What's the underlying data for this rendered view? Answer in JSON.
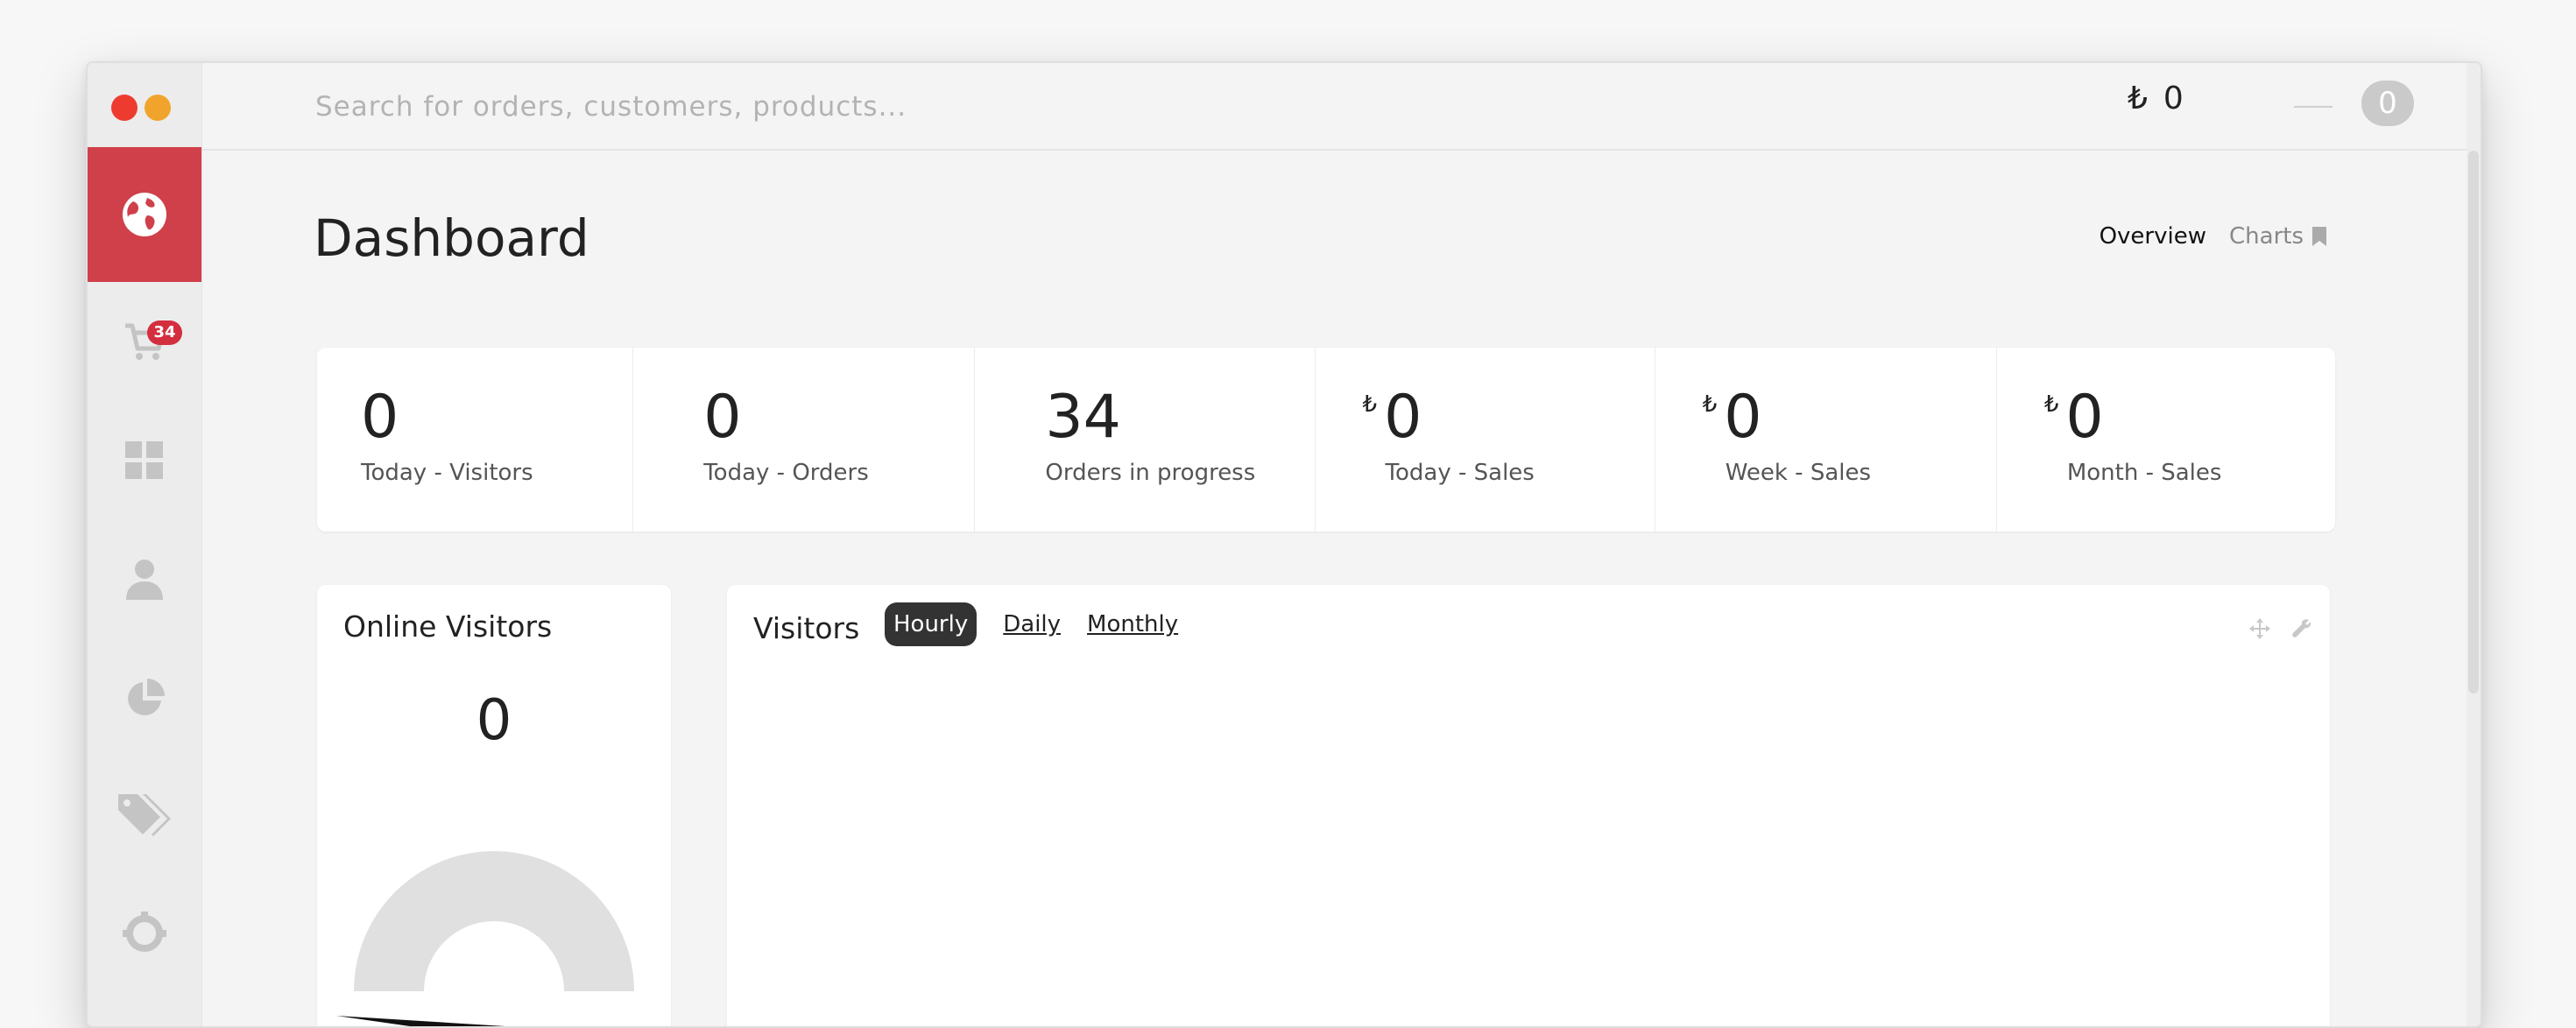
{
  "search": {
    "placeholder": "Search for orders, customers, products..."
  },
  "header": {
    "currency_symbol": "₺",
    "cart_total": "0",
    "notification_count": "0"
  },
  "sidebar": {
    "items": [
      {
        "icon": "globe-icon",
        "active": true
      },
      {
        "icon": "cart-icon",
        "badge": "34"
      },
      {
        "icon": "dashboard-grid-icon"
      },
      {
        "icon": "user-icon"
      },
      {
        "icon": "pie-chart-icon"
      },
      {
        "icon": "tags-icon"
      },
      {
        "icon": "settings-icon"
      }
    ]
  },
  "page": {
    "title": "Dashboard",
    "tabs": [
      {
        "label": "Overview",
        "active": true
      },
      {
        "label": "Charts",
        "icon": "bookmark-icon"
      }
    ]
  },
  "stats": [
    {
      "value": "0",
      "label": "Today - Visitors"
    },
    {
      "value": "0",
      "label": "Today - Orders"
    },
    {
      "value": "34",
      "label": "Orders in progress"
    },
    {
      "currency": "₺",
      "value": "0",
      "label": "Today - Sales"
    },
    {
      "currency": "₺",
      "value": "0",
      "label": "Week - Sales"
    },
    {
      "currency": "₺",
      "value": "0",
      "label": "Month - Sales"
    }
  ],
  "online_visitors": {
    "title": "Online Visitors",
    "count": "0"
  },
  "visitors_chart": {
    "title": "Visitors",
    "periods": [
      {
        "label": "Hourly",
        "active": true
      },
      {
        "label": "Daily"
      },
      {
        "label": "Monthly"
      }
    ],
    "tool_icons": [
      "move-icon",
      "wrench-icon"
    ]
  },
  "colors": {
    "accent": "#d0404a",
    "badge": "#d32f3f",
    "traffic_red": "#ee3b2f",
    "traffic_yellow": "#f1a42c"
  }
}
